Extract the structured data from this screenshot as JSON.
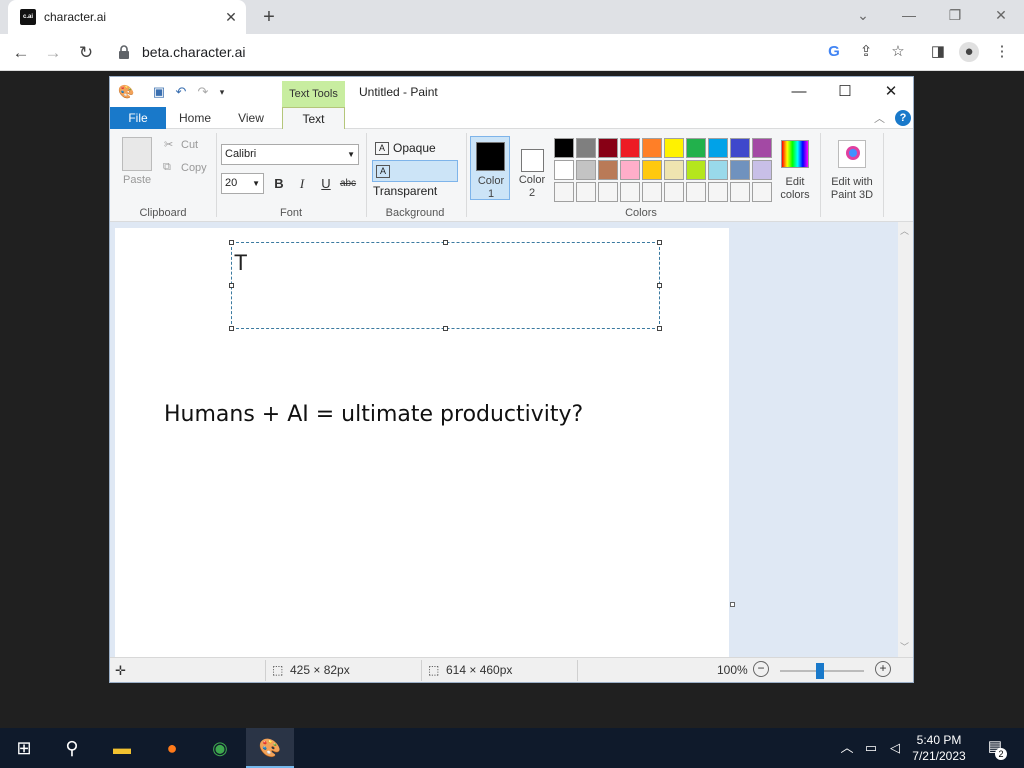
{
  "browser": {
    "tab_favicon": "c.ai",
    "tab_title": "character.ai",
    "url": "beta.character.ai",
    "icons": [
      "back-icon",
      "forward-icon",
      "reload-icon",
      "lock-icon",
      "google-icon",
      "share-icon",
      "bookmark-icon",
      "sidepanel-icon",
      "profile-icon",
      "menu-icon"
    ]
  },
  "paint": {
    "context_tab": "Text Tools",
    "window_title": "Untitled - Paint",
    "ribbon_tabs": {
      "file": "File",
      "home": "Home",
      "view": "View",
      "text": "Text"
    },
    "clipboard": {
      "paste": "Paste",
      "cut": "Cut",
      "copy": "Copy",
      "label": "Clipboard"
    },
    "font": {
      "family": "Calibri",
      "size": "20",
      "bold": "B",
      "italic": "I",
      "underline": "U",
      "strike": "abc",
      "label": "Font"
    },
    "background": {
      "opaque": "Opaque",
      "transparent": "Transparent",
      "label": "Background"
    },
    "colors": {
      "color1_line1": "Color",
      "color1_line2": "1",
      "color2_line1": "Color",
      "color2_line2": "2",
      "edit_line1": "Edit",
      "edit_line2": "colors",
      "label": "Colors",
      "palette_row1": [
        "#000000",
        "#7f7f7f",
        "#880015",
        "#ed1c24",
        "#ff7f27",
        "#fff200",
        "#22b14c",
        "#00a2e8",
        "#3f48cc",
        "#a349a4"
      ],
      "palette_row2": [
        "#ffffff",
        "#c3c3c3",
        "#b97a57",
        "#ffaec9",
        "#ffc90e",
        "#efe4b0",
        "#b5e61d",
        "#99d9ea",
        "#7092be",
        "#c8bfe7"
      ],
      "palette_row3": [
        "#f5f5f5",
        "#f5f5f5",
        "#f5f5f5",
        "#f5f5f5",
        "#f5f5f5",
        "#f5f5f5",
        "#f5f5f5",
        "#f5f5f5",
        "#f5f5f5",
        "#f5f5f5"
      ]
    },
    "paint3d": {
      "line1": "Edit with",
      "line2": "Paint 3D"
    },
    "canvas": {
      "typing_text": "T",
      "text": "Humans + AI = ultimate productivity?"
    },
    "status": {
      "selection_size": "425 × 82px",
      "canvas_size": "614 × 460px",
      "zoom": "100%"
    }
  },
  "taskbar": {
    "time": "5:40 PM",
    "date": "7/21/2023",
    "notifications": "2"
  }
}
